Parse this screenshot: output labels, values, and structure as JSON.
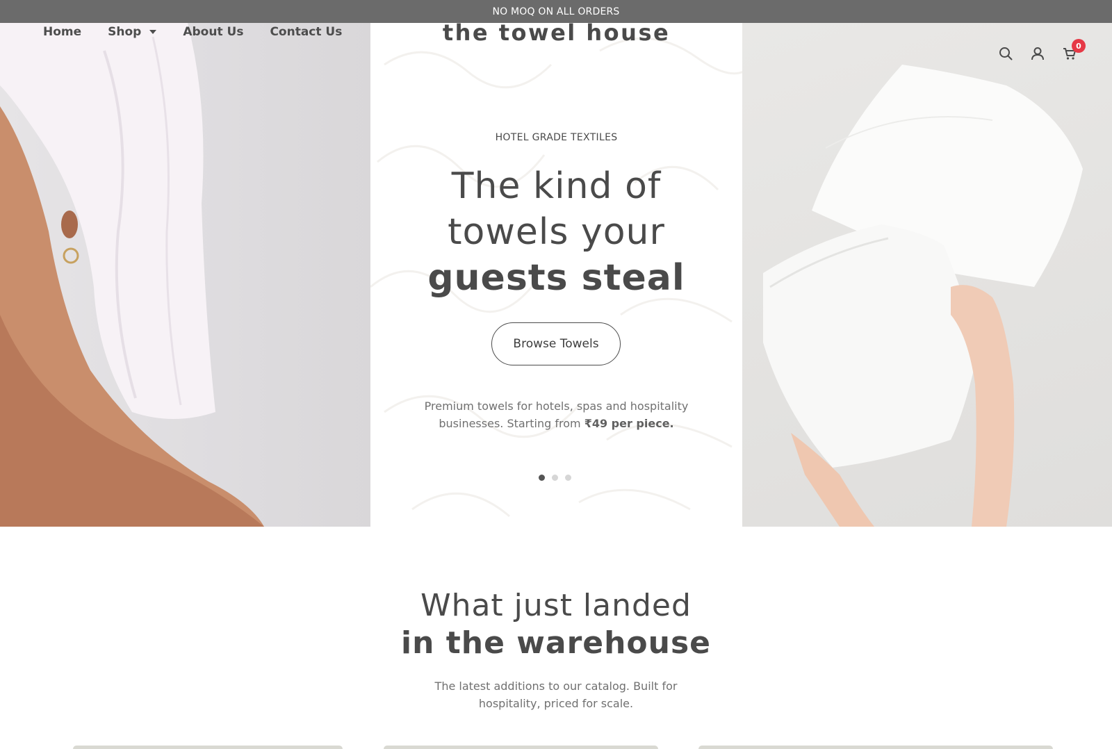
{
  "announcement": {
    "text": "NO MOQ ON ALL ORDERS"
  },
  "header": {
    "brand": "the towel house",
    "nav": [
      {
        "label": "Home"
      },
      {
        "label": "Shop"
      },
      {
        "label": "About Us"
      },
      {
        "label": "Contact Us"
      }
    ],
    "icons": [
      "search-icon",
      "user-icon",
      "cart-icon"
    ],
    "cart_count": "0"
  },
  "hero": {
    "eyebrow": "HOTEL GRADE TEXTILES",
    "headline_line1": "The kind of",
    "headline_line2": "towels your",
    "headline_line3": "guests steal",
    "cta_label": "Browse Towels",
    "desc_line1": "Premium towels for hotels, spas and hospitality",
    "desc_line2_prefix": "businesses. Starting from ",
    "desc_price": "₹49 per piece.",
    "slide_count": 3,
    "active_slide": 1
  },
  "section": {
    "title_line1": "What just landed",
    "title_line2": "in the warehouse",
    "sub_line1": "The latest additions to our catalog. Built for",
    "sub_line2": "hospitality, priced for scale."
  },
  "colors": {
    "announcement_bg": "#6b6b6b",
    "text": "#4a4a4a",
    "muted": "#707070",
    "badge": "#e63946"
  }
}
